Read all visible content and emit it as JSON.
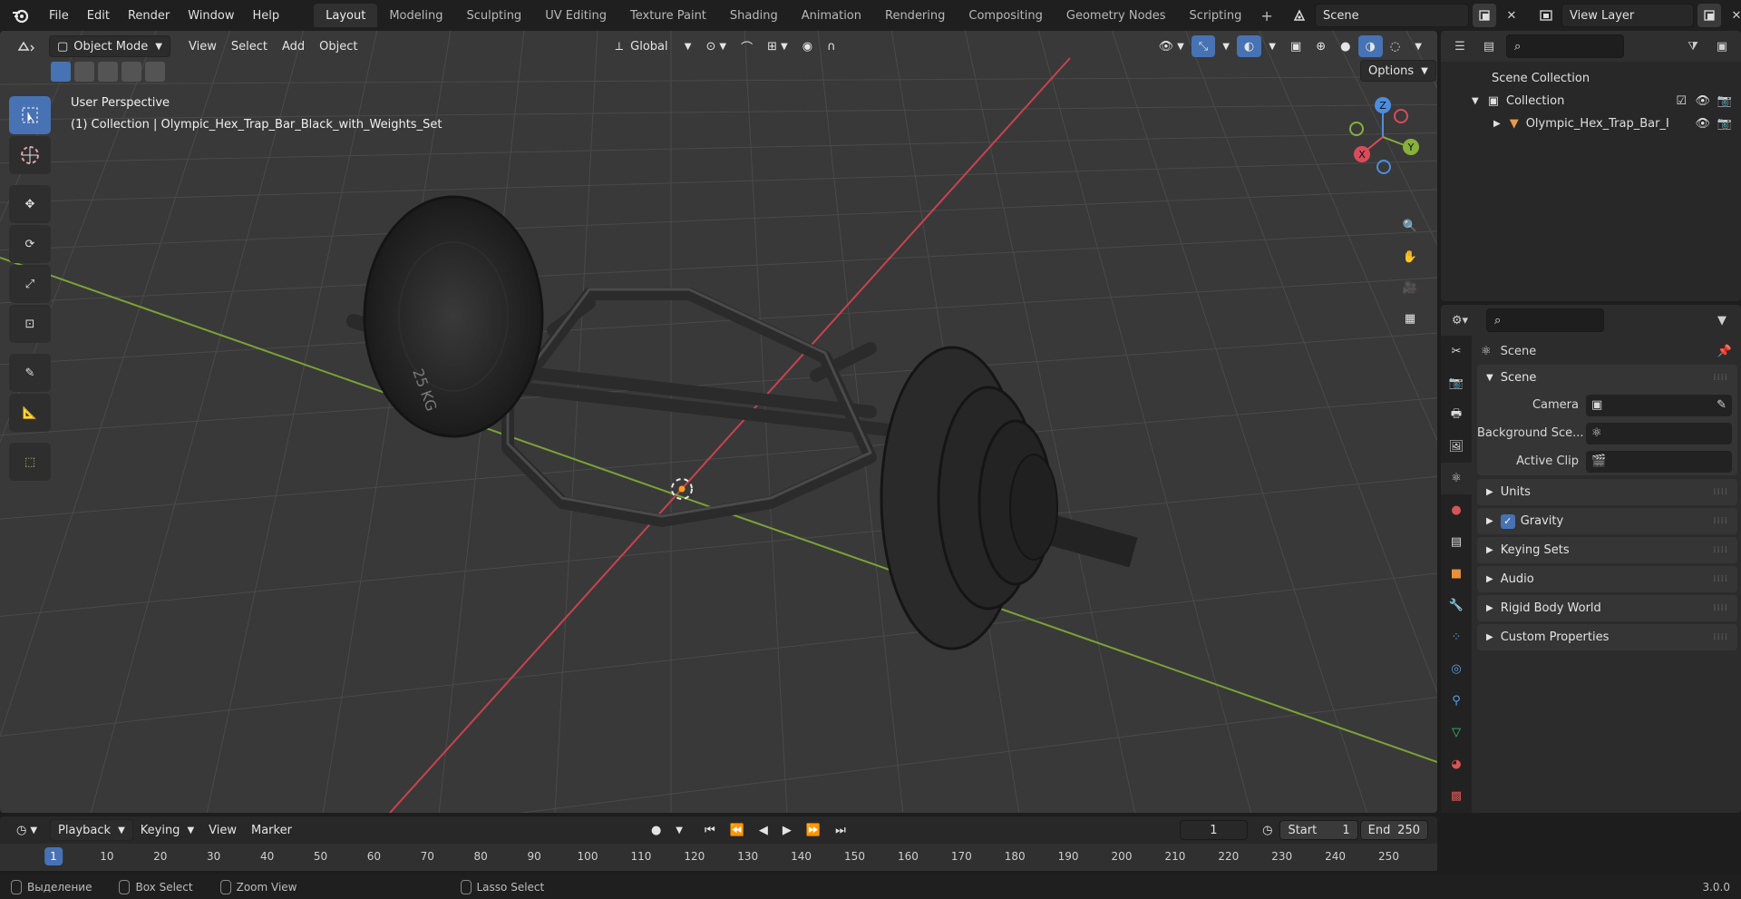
{
  "menu": [
    "File",
    "Edit",
    "Render",
    "Window",
    "Help"
  ],
  "workspace_tabs": [
    "Layout",
    "Modeling",
    "Sculpting",
    "UV Editing",
    "Texture Paint",
    "Shading",
    "Animation",
    "Rendering",
    "Compositing",
    "Geometry Nodes",
    "Scripting"
  ],
  "active_tab": "Layout",
  "scene_name": "Scene",
  "view_layer": "View Layer",
  "viewport": {
    "mode": "Object Mode",
    "menus": [
      "View",
      "Select",
      "Add",
      "Object"
    ],
    "orientation": "Global",
    "options_label": "Options",
    "overlay_line1": "User Perspective",
    "overlay_line2": "(1) Collection | Olympic_Hex_Trap_Bar_Black_with_Weights_Set",
    "plate_label": "25 KG",
    "gizmo": {
      "z": "Z",
      "y": "Y",
      "x": "X"
    }
  },
  "outliner": {
    "scene_collection": "Scene Collection",
    "collection": "Collection",
    "object": "Olympic_Hex_Trap_Bar_I"
  },
  "properties": {
    "title": "Scene",
    "scene_panel": "Scene",
    "rows": [
      {
        "label": "Camera"
      },
      {
        "label": "Background Sce..."
      },
      {
        "label": "Active Clip"
      }
    ],
    "panels": [
      "Units",
      "Gravity",
      "Keying Sets",
      "Audio",
      "Rigid Body World",
      "Custom Properties"
    ]
  },
  "timeline": {
    "menus": [
      "Playback",
      "Keying",
      "View",
      "Marker"
    ],
    "current_frame": "1",
    "start_label": "Start",
    "start": "1",
    "end_label": "End",
    "end": "250",
    "ticks": [
      "1",
      "10",
      "20",
      "30",
      "40",
      "50",
      "60",
      "70",
      "80",
      "90",
      "100",
      "110",
      "120",
      "130",
      "140",
      "150",
      "160",
      "170",
      "180",
      "190",
      "200",
      "210",
      "220",
      "230",
      "240",
      "250"
    ]
  },
  "status": {
    "select": "Выделение",
    "box": "Box Select",
    "zoom": "Zoom View",
    "lasso": "Lasso Select",
    "version": "3.0.0"
  },
  "colors": {
    "accent": "#4772b3",
    "x_axis": "#d94b5b",
    "y_axis": "#86b13a",
    "z_axis": "#4c8de0",
    "grid": "#4a4a4a"
  }
}
